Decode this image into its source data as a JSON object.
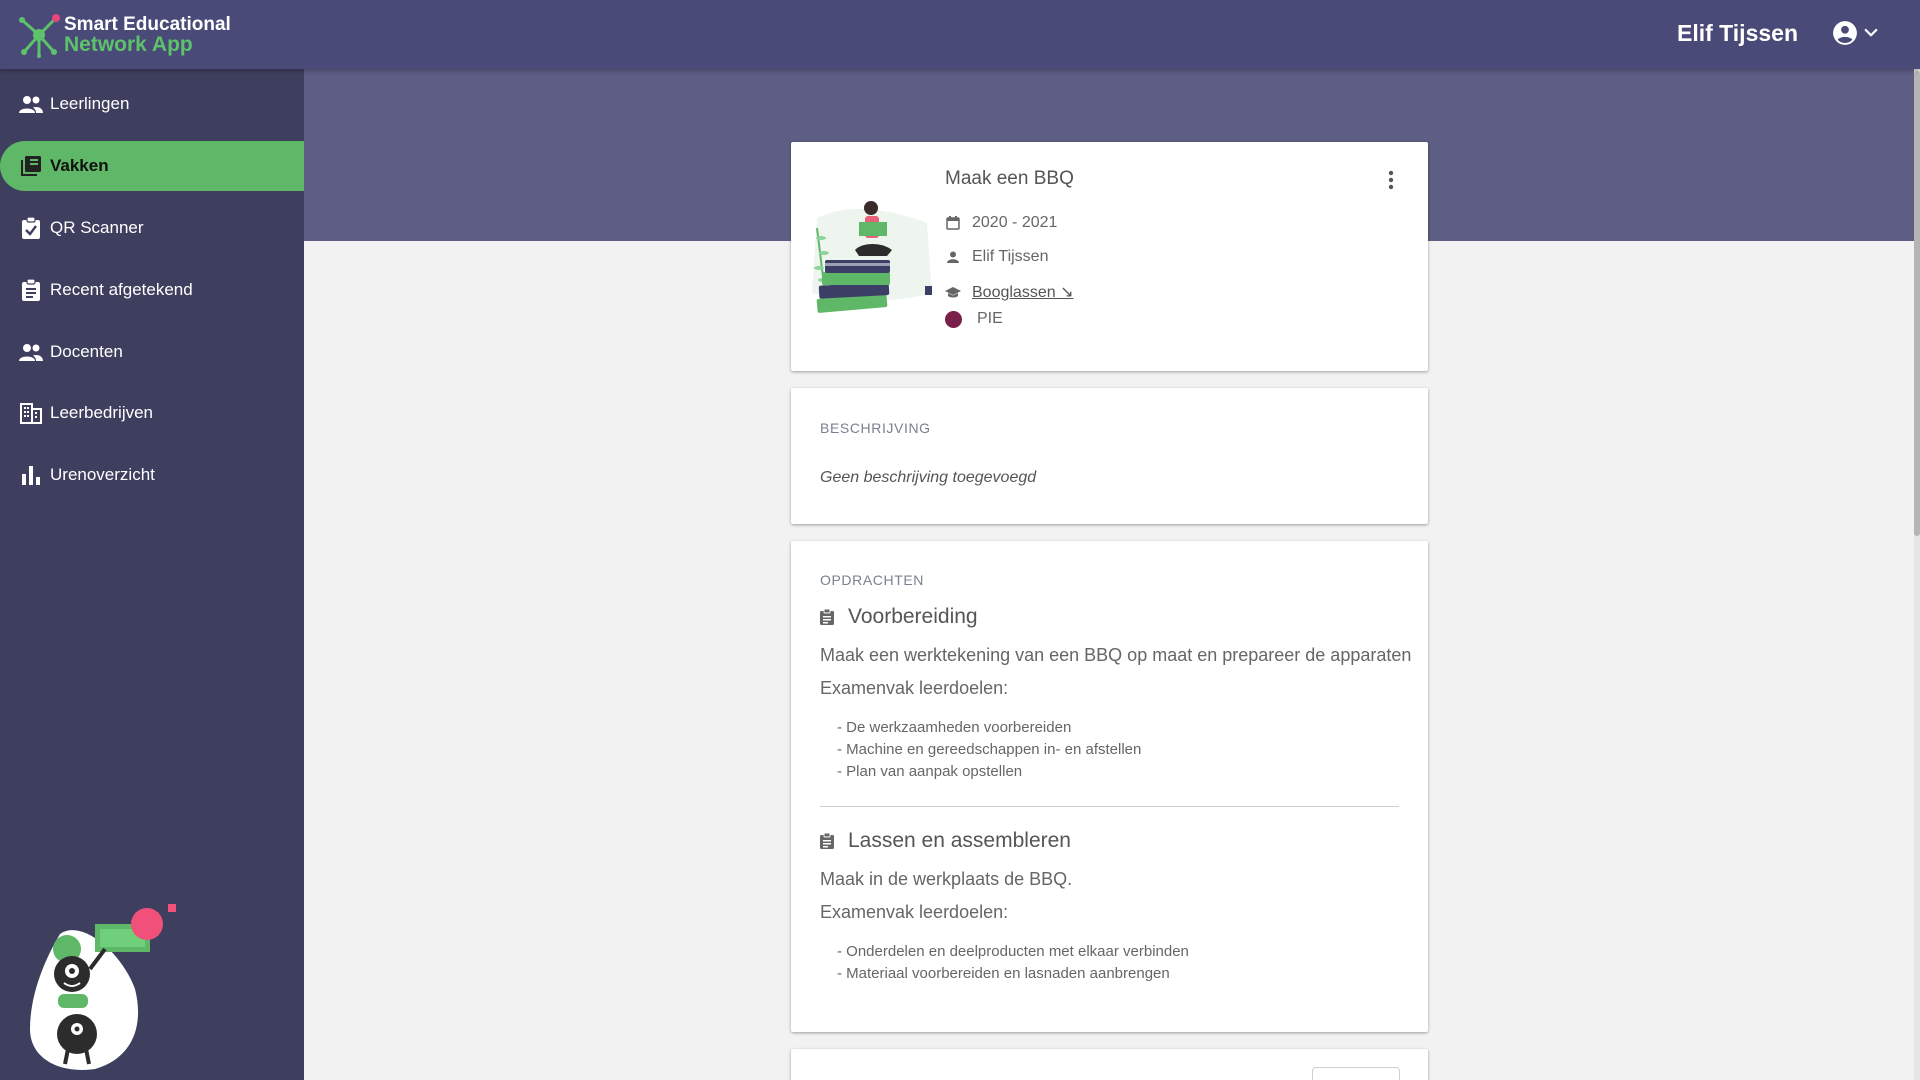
{
  "app": {
    "name_line1": "Smart Educational",
    "name_line2": "Network App",
    "colors": {
      "header": "#4a4a78",
      "sidebar": "#3e3e5e",
      "accent": "#5fb868",
      "band": "#5e5e85"
    }
  },
  "header": {
    "user_name": "Elif Tijssen",
    "user_icon": "account-circle-icon",
    "menu_icon": "chevron-down-icon"
  },
  "sidebar": {
    "items": [
      {
        "label": "Leerlingen",
        "icon": "people-icon",
        "active": false
      },
      {
        "label": "Vakken",
        "icon": "library-books-icon",
        "active": true
      },
      {
        "label": "QR Scanner",
        "icon": "clipboard-check-icon",
        "active": false
      },
      {
        "label": "Recent afgetekend",
        "icon": "clipboard-text-icon",
        "active": false
      },
      {
        "label": "Docenten",
        "icon": "people-icon",
        "active": false
      },
      {
        "label": "Leerbedrijven",
        "icon": "building-icon",
        "active": false
      },
      {
        "label": "Urenoverzicht",
        "icon": "bar-chart-icon",
        "active": false
      }
    ]
  },
  "subject": {
    "title": "Maak een BBQ",
    "year": "2020 - 2021",
    "teacher": "Elif Tijssen",
    "course": "Booglassen ↘",
    "tag": "PIE",
    "tag_color": "#7a1f4a"
  },
  "description": {
    "label": "BESCHRIJVING",
    "text": "Geen beschrijving toegevoegd"
  },
  "assignments": {
    "label": "OPDRACHTEN",
    "items": [
      {
        "title": "Voorbereiding",
        "text": "Maak een werktekening van een BBQ op maat en prepareer de apparaten",
        "goals_label": "Examenvak leerdoelen:",
        "goals": [
          "- De werkzaamheden voorbereiden",
          "- Machine en gereedschappen in- en afstellen",
          "- Plan van aanpak opstellen"
        ]
      },
      {
        "title": "Lassen en assembleren",
        "text": "Maak in de werkplaats de BBQ.",
        "goals_label": "Examenvak leerdoelen:",
        "goals": [
          "- Onderdelen en deelproducten met elkaar verbinden",
          "- Materiaal voorbereiden en lasnaden aanbrengen"
        ]
      }
    ]
  }
}
